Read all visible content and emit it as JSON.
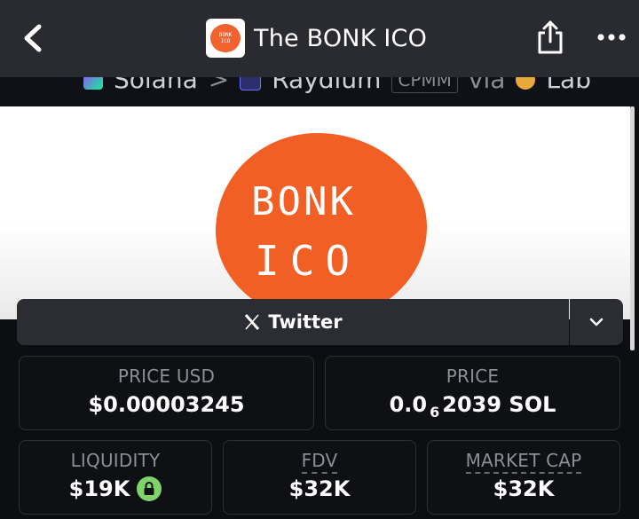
{
  "header": {
    "title": "The BONK ICO",
    "favicon_text": [
      "BONK",
      "ICO"
    ]
  },
  "breadcrumb": {
    "chain": "Solana",
    "separator": ">",
    "dex": "Raydium",
    "pool_type": "CPMM",
    "via_label": "via",
    "launchpad": "Lab"
  },
  "banner": {
    "art_line1": "BONK",
    "art_line2": "ICO"
  },
  "social": {
    "twitter_label": "Twitter"
  },
  "stats": {
    "price_usd": {
      "label": "PRICE USD",
      "value": "$0.00003245"
    },
    "price": {
      "label": "PRICE",
      "prefix": "0.0",
      "zeros": "6",
      "suffix": "2039 SOL"
    },
    "liquidity": {
      "label": "LIQUIDITY",
      "value": "$19K"
    },
    "fdv": {
      "label": "FDV",
      "value": "$32K"
    },
    "market_cap": {
      "label": "MARKET CAP",
      "value": "$32K"
    }
  },
  "colors": {
    "accent_orange": "#f25f24",
    "lock_green": "#7fd36a",
    "bar_bg": "#2a2b30"
  }
}
